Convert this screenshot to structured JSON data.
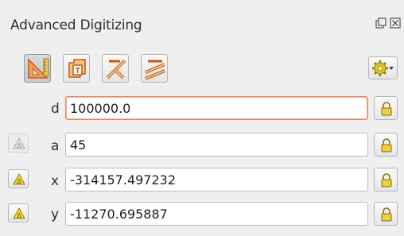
{
  "panel": {
    "title": "Advanced Digitizing"
  },
  "toolbar": {
    "tools": [
      {
        "icon": "construction-mode-icon",
        "active": true
      },
      {
        "icon": "parallel-perpendicular-icon",
        "active": false
      },
      {
        "icon": "perpendicular-icon",
        "active": false
      },
      {
        "icon": "parallel-icon",
        "active": false
      }
    ],
    "settings_icon": "gear-dropdown-icon"
  },
  "fields": {
    "d": {
      "label": "d",
      "value": "100000.0",
      "focused": true
    },
    "a": {
      "label": "a",
      "value": "45"
    },
    "x": {
      "label": "x",
      "value": "-314157.497232"
    },
    "y": {
      "label": "y",
      "value": "-11270.695887"
    }
  },
  "colors": {
    "accent": "#e06a2c",
    "lock": "#e7bf2a",
    "focus_border": "#e9835e"
  }
}
